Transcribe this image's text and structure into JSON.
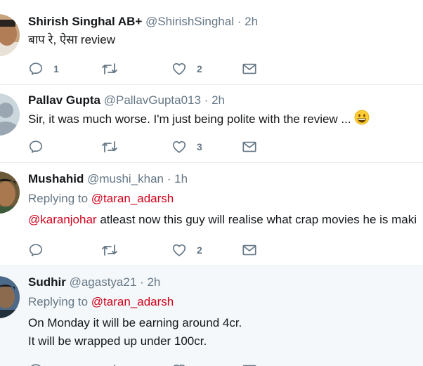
{
  "tweets": [
    {
      "name": "Shirish Singhal AB+",
      "handle": "@ShirishSinghal",
      "separator": "·",
      "time": "2h",
      "text": "बाप रे, ऐसा review",
      "replies": "1",
      "retweets": "",
      "likes": "2"
    },
    {
      "name": "Pallav Gupta",
      "handle": "@PallavGupta013",
      "separator": "·",
      "time": "2h",
      "text": "Sir, it was much worse. I'm just being polite with the review ...",
      "emoji": "grinning-face-emoji",
      "replies": "",
      "retweets": "",
      "likes": "3"
    },
    {
      "name": "Mushahid",
      "handle": "@mushi_khan",
      "separator": "·",
      "time": "1h",
      "replying_label": "Replying to",
      "replying_to": "@taran_adarsh",
      "mention": "@karanjohar",
      "text": "atleast now this guy will realise what crap movies he is maki",
      "replies": "",
      "retweets": "",
      "likes": "2"
    },
    {
      "name": "Sudhir",
      "handle": "@agastya21",
      "separator": "·",
      "time": "2h",
      "replying_label": "Replying to",
      "replying_to": "@taran_adarsh",
      "text_line1": "On Monday it will be earning around 4cr.",
      "text_line2": "It will be wrapped up under 100cr."
    }
  ],
  "colors": {
    "mention": "#d0021b",
    "muted": "#657786",
    "text": "#14171a",
    "highlight_bg": "#f5f8fa",
    "border": "#e6ecf0"
  },
  "icons": [
    "reply-icon",
    "retweet-icon",
    "like-icon",
    "direct-message-icon"
  ]
}
